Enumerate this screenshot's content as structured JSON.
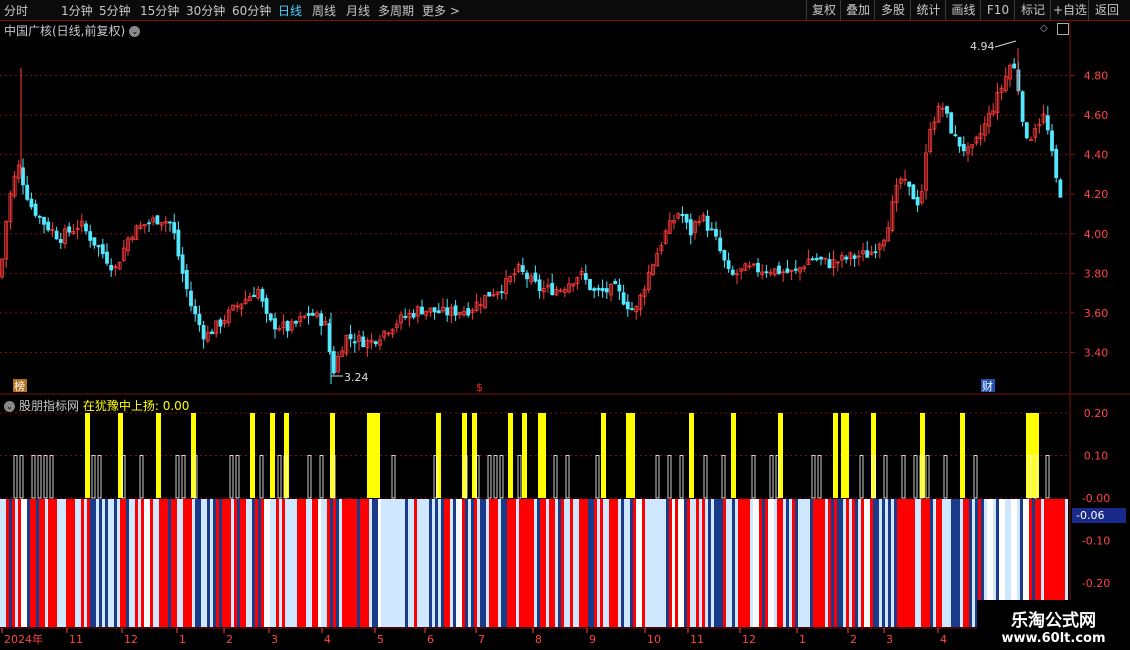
{
  "toolbar": {
    "periods": [
      "分时",
      "1分钟",
      "5分钟",
      "15分钟",
      "30分钟",
      "60分钟",
      "日线",
      "周线",
      "月线",
      "多周期",
      "更多 >"
    ],
    "active": "日线",
    "actions": [
      "复权",
      "叠加",
      "多股",
      "统计",
      "画线",
      "F10",
      "标记",
      "+自选",
      "返回"
    ]
  },
  "main": {
    "title": "中国广核(日线,前复权)",
    "high_label": "4.94",
    "low_label": "3.24",
    "markers": {
      "bang": "榜",
      "s": "$",
      "cai": "财"
    },
    "y_ticks": [
      "4.80",
      "4.60",
      "4.40",
      "4.20",
      "4.00",
      "3.80",
      "3.60",
      "3.40"
    ]
  },
  "indicator": {
    "name": "股朋指标网",
    "label": "在犹豫中上扬: 0.00",
    "y_ticks": [
      "0.20",
      "0.10",
      "-0.00",
      "-0.10",
      "-0.20"
    ],
    "current_value": "-0.06"
  },
  "x_axis": [
    "2024年",
    "11",
    "12",
    "1",
    "2",
    "3",
    "4",
    "5",
    "6",
    "7",
    "8",
    "9",
    "10",
    "11",
    "12",
    "1",
    "2",
    "3",
    "4"
  ],
  "logo": {
    "line1": "乐淘公式网",
    "line2": "www.60lt.com"
  },
  "colors": {
    "up": "#ff3b3b",
    "down": "#54e8ff",
    "yellow": "#ffff00",
    "grid": "#7a1010",
    "red_bar": "#ff0000"
  },
  "chart_data": {
    "type": "candlestick",
    "title": "中国广核(日线,前复权)",
    "ylim": [
      3.2,
      5.0
    ],
    "price_points": [
      [
        0,
        3.78
      ],
      [
        8,
        4.15
      ],
      [
        18,
        4.35
      ],
      [
        30,
        4.15
      ],
      [
        45,
        4.05
      ],
      [
        60,
        3.98
      ],
      [
        80,
        4.05
      ],
      [
        100,
        3.92
      ],
      [
        115,
        3.82
      ],
      [
        130,
        4.0
      ],
      [
        145,
        4.05
      ],
      [
        160,
        4.08
      ],
      [
        172,
        4.05
      ],
      [
        180,
        3.85
      ],
      [
        192,
        3.62
      ],
      [
        205,
        3.48
      ],
      [
        220,
        3.55
      ],
      [
        240,
        3.65
      ],
      [
        258,
        3.72
      ],
      [
        268,
        3.55
      ],
      [
        290,
        3.52
      ],
      [
        310,
        3.6
      ],
      [
        325,
        3.55
      ],
      [
        333,
        3.3
      ],
      [
        345,
        3.48
      ],
      [
        370,
        3.45
      ],
      [
        395,
        3.55
      ],
      [
        420,
        3.62
      ],
      [
        445,
        3.6
      ],
      [
        470,
        3.62
      ],
      [
        490,
        3.7
      ],
      [
        505,
        3.74
      ],
      [
        518,
        3.82
      ],
      [
        540,
        3.72
      ],
      [
        560,
        3.72
      ],
      [
        580,
        3.8
      ],
      [
        595,
        3.7
      ],
      [
        615,
        3.72
      ],
      [
        635,
        3.6
      ],
      [
        650,
        3.82
      ],
      [
        665,
        4.0
      ],
      [
        680,
        4.12
      ],
      [
        690,
        4.0
      ],
      [
        700,
        4.1
      ],
      [
        715,
        3.98
      ],
      [
        730,
        3.78
      ],
      [
        745,
        3.82
      ],
      [
        770,
        3.82
      ],
      [
        795,
        3.8
      ],
      [
        810,
        3.88
      ],
      [
        830,
        3.85
      ],
      [
        850,
        3.88
      ],
      [
        870,
        3.9
      ],
      [
        885,
        4.0
      ],
      [
        900,
        4.28
      ],
      [
        912,
        4.2
      ],
      [
        920,
        4.15
      ],
      [
        930,
        4.55
      ],
      [
        942,
        4.65
      ],
      [
        955,
        4.48
      ],
      [
        970,
        4.4
      ],
      [
        985,
        4.55
      ],
      [
        1000,
        4.72
      ],
      [
        1012,
        4.88
      ],
      [
        1018,
        4.75
      ],
      [
        1027,
        4.45
      ],
      [
        1035,
        4.55
      ],
      [
        1045,
        4.6
      ],
      [
        1050,
        4.45
      ],
      [
        1058,
        4.22
      ],
      [
        1063,
        4.2
      ]
    ],
    "high": 4.94,
    "low": 3.24
  }
}
